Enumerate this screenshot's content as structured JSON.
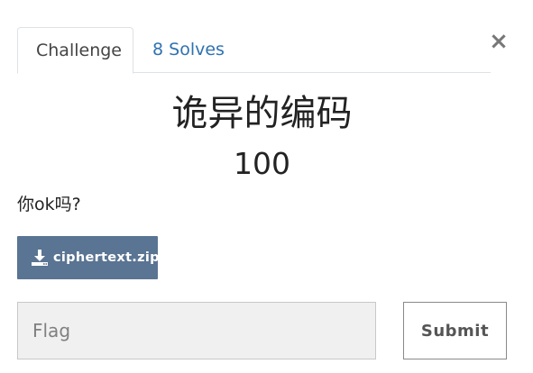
{
  "tabs": {
    "challenge_label": "Challenge",
    "solves_label": "8 Solves"
  },
  "close_label": "×",
  "challenge": {
    "name": "诡异的编码",
    "points": "100",
    "description": "你ok吗?"
  },
  "file": {
    "name": "ciphertext.zip",
    "icon": "download-icon"
  },
  "form": {
    "flag_placeholder": "Flag",
    "flag_value": "",
    "submit_label": "Submit"
  },
  "colors": {
    "tab_link": "#2f72b0",
    "file_button": "#5a7493",
    "input_background": "#f0f0f0"
  }
}
